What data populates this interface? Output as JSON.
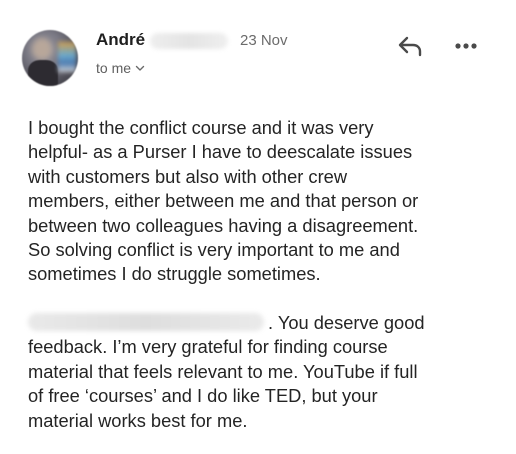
{
  "email": {
    "sender_first_name": "André",
    "date": "23 Nov",
    "recipient_label": "to me",
    "icons": {
      "reply": "reply-icon",
      "more": "more-options-icon",
      "expand": "chevron-down-icon"
    },
    "paragraph1_lines": [
      "I bought the conflict course and it was very",
      "helpful- as a Purser I have to deescalate issues",
      "with customers but also with other crew",
      "members, either between me and that person or",
      "between two colleagues having a disagreement.",
      "So solving conflict is very important to me and",
      "sometimes I do struggle sometimes."
    ],
    "paragraph2_first_line_visible": ". You deserve good",
    "paragraph2_lines": [
      "feedback. I’m very grateful for finding course",
      "material that feels relevant to me. YouTube if full",
      "of free ‘courses’ and I do like TED, but your",
      "material works best for me."
    ]
  }
}
